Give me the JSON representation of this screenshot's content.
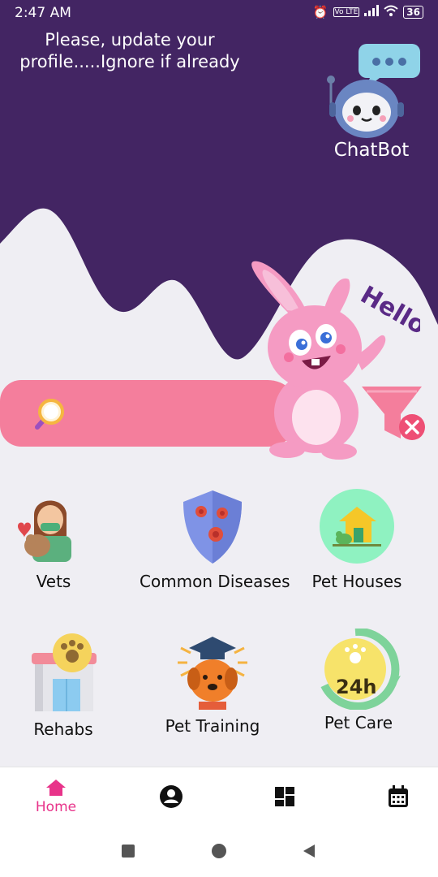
{
  "status": {
    "time": "2:47 AM",
    "battery": "36",
    "volte": "Vo LTE"
  },
  "header": {
    "message": "Please, update your profile.....Ignore if already",
    "chatbot_label": "ChatBot"
  },
  "hero": {
    "hello_text": "Hello"
  },
  "search": {
    "placeholder": ""
  },
  "categories": [
    {
      "label": "Vets"
    },
    {
      "label": "Common Diseases"
    },
    {
      "label": "Pet Houses"
    },
    {
      "label": "Rehabs"
    },
    {
      "label": "Pet Training"
    },
    {
      "label": "Pet Care"
    }
  ],
  "badges": {
    "pet_care_24h": "24h"
  },
  "bottom_nav": {
    "home_label": "Home",
    "active_color": "#e8338a"
  },
  "colors": {
    "header_purple": "#432563",
    "search_pink": "#f47e9c",
    "background": "#efeef3"
  }
}
